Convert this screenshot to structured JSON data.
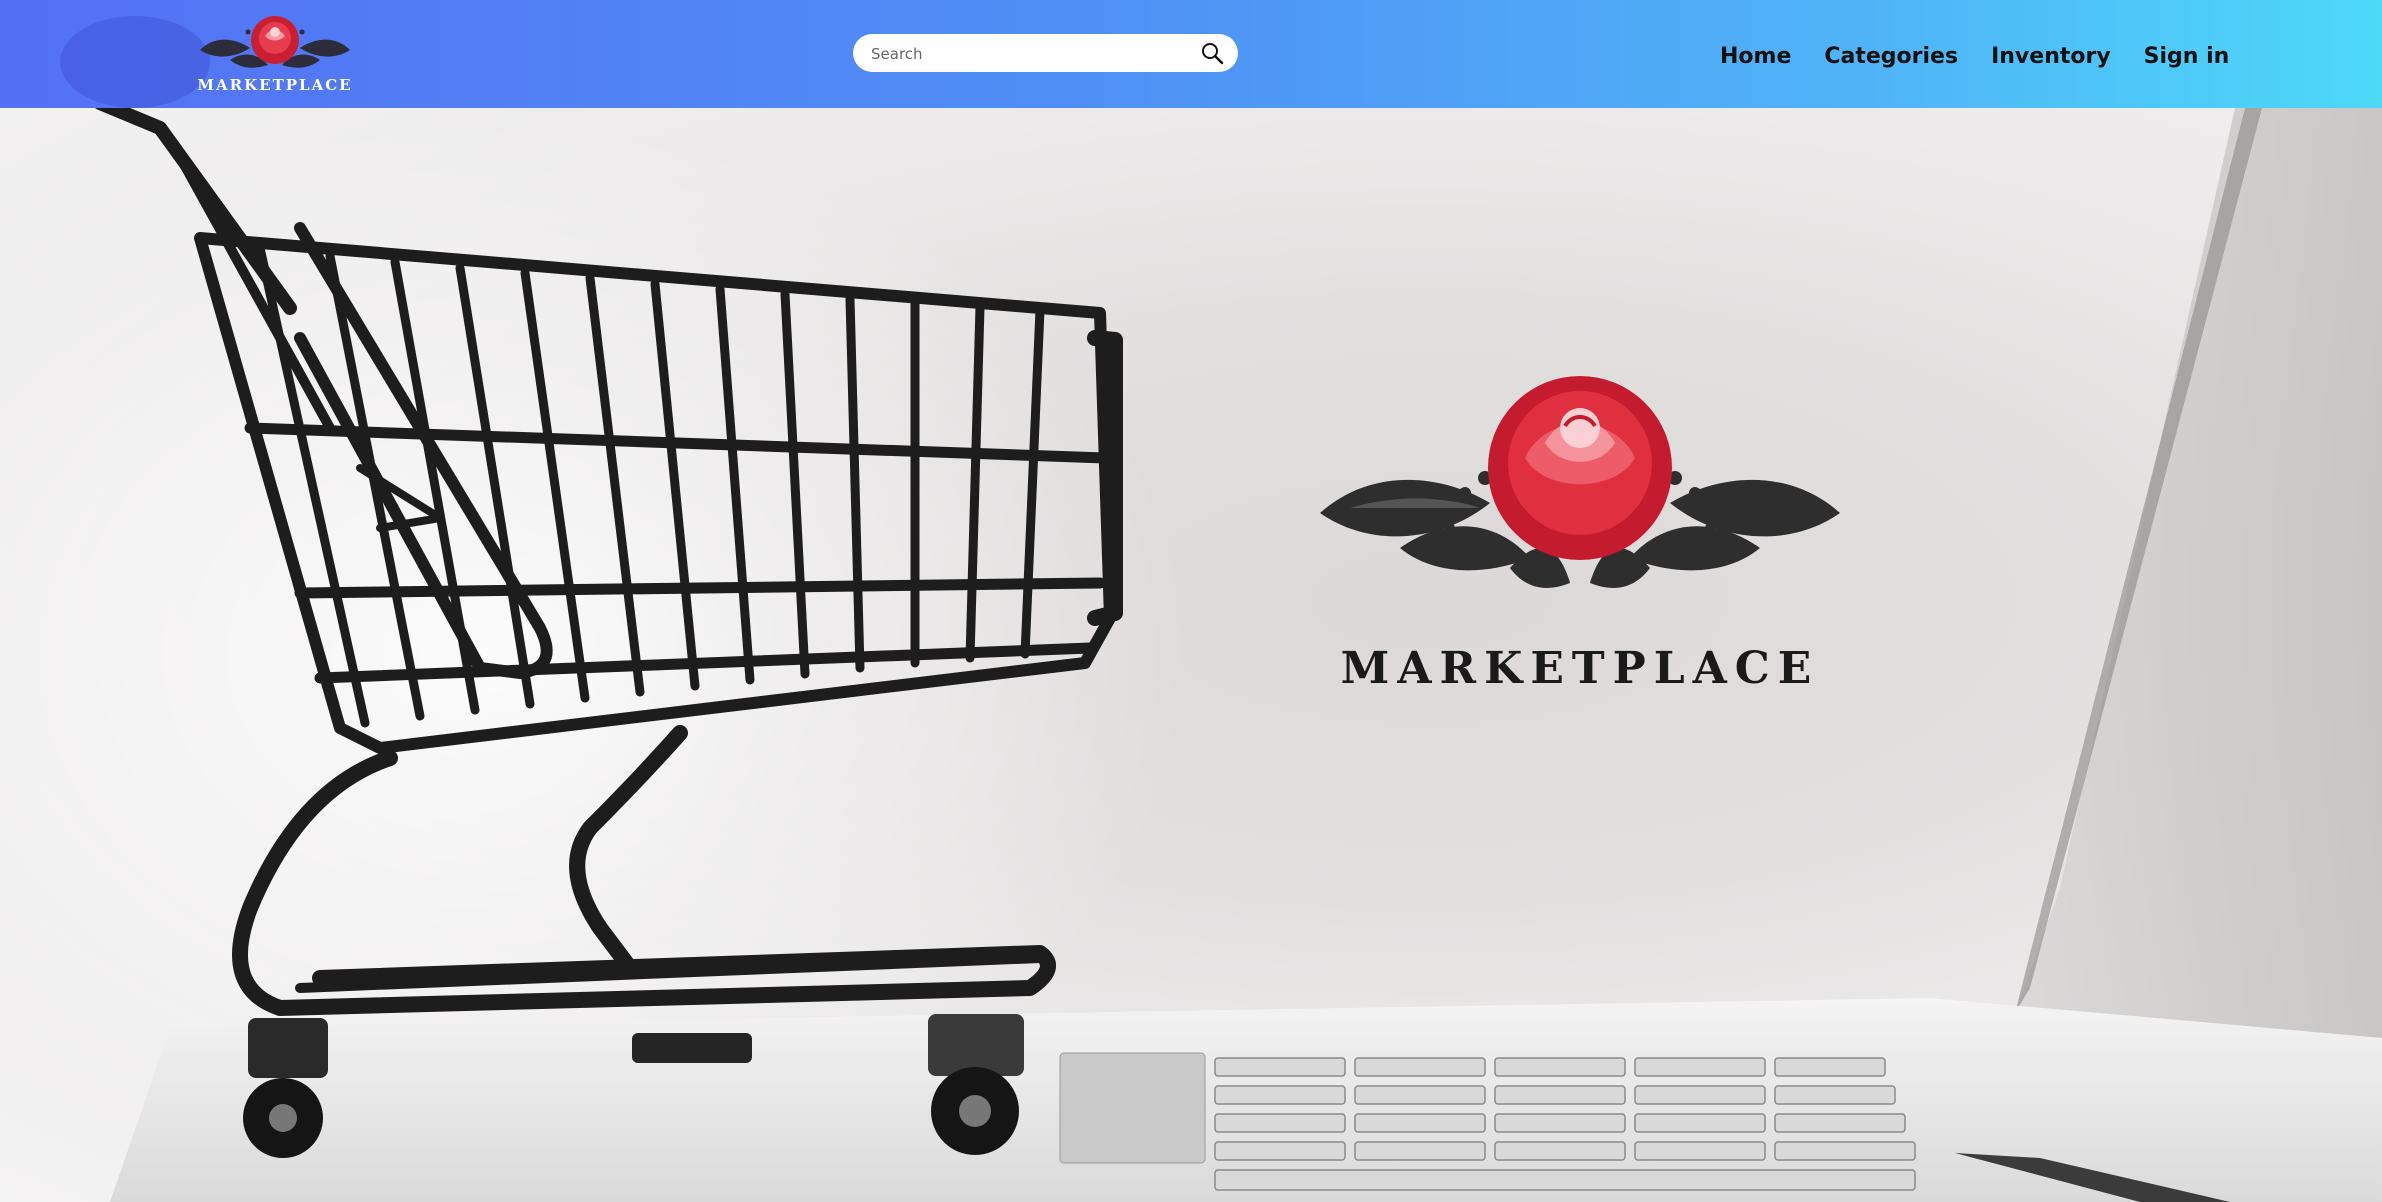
{
  "brand": {
    "name": "MARKETPLACE"
  },
  "search": {
    "placeholder": "Search",
    "icon": "search-icon"
  },
  "nav": {
    "links": [
      {
        "label": "Home"
      },
      {
        "label": "Categories"
      },
      {
        "label": "Inventory"
      },
      {
        "label": "Sign in"
      }
    ]
  },
  "hero": {
    "logo_text": "MARKETPLACE"
  },
  "colors": {
    "nav_gradient_start": "#5470f5",
    "nav_gradient_end": "#4dd9f8",
    "rose": "#d8283a",
    "leaves": "#3a3a3a",
    "nav_text": "#111111"
  }
}
